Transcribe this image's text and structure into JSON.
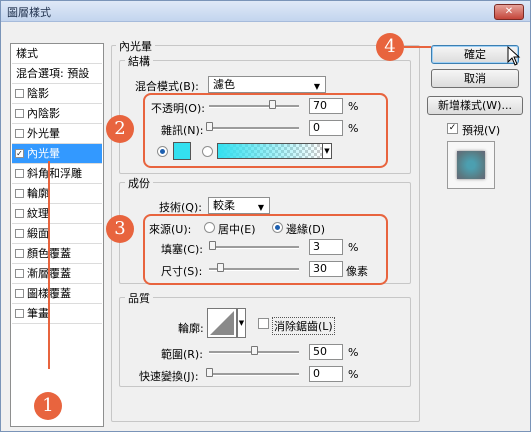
{
  "window": {
    "title": "圖層樣式",
    "close_label": "✕"
  },
  "sidebar": {
    "header": "樣式",
    "blend": "混合選項: 預設",
    "items": [
      {
        "label": "陰影",
        "checked": false
      },
      {
        "label": "內陰影",
        "checked": false
      },
      {
        "label": "外光暈",
        "checked": false
      },
      {
        "label": "內光暈",
        "checked": true
      },
      {
        "label": "斜角和浮雕",
        "checked": false
      },
      {
        "label": "輪廓",
        "checked": false
      },
      {
        "label": "紋理",
        "checked": false
      },
      {
        "label": "緞面",
        "checked": false
      },
      {
        "label": "顏色覆蓋",
        "checked": false
      },
      {
        "label": "漸層覆蓋",
        "checked": false
      },
      {
        "label": "圖樣覆蓋",
        "checked": false
      },
      {
        "label": "筆畫",
        "checked": false
      }
    ]
  },
  "inner_glow": {
    "title": "內光暈",
    "structure": {
      "title": "結構",
      "blend_label": "混合模式(B):",
      "blend_value": "濾色",
      "opacity_label": "不透明(O):",
      "opacity_value": "70",
      "opacity_unit": "%",
      "opacity_level": 0.7,
      "noise_label": "雜訊(N):",
      "noise_value": "0",
      "noise_unit": "%",
      "noise_level": 0.0,
      "glow_color": "#33e0f0"
    },
    "elements": {
      "title": "成份",
      "technique_label": "技術(Q):",
      "technique_value": "較柔",
      "source_label": "來源(U):",
      "source_center": "居中(E)",
      "source_edge": "邊緣(D)",
      "choke_label": "填塞(C):",
      "choke_value": "3",
      "choke_unit": "%",
      "choke_level": 0.03,
      "size_label": "尺寸(S):",
      "size_value": "30",
      "size_unit": "像素",
      "size_level": 0.12
    },
    "quality": {
      "title": "品質",
      "contour_label": "輪廓:",
      "antialias_label": "消除鋸齒(L)",
      "range_label": "範圍(R):",
      "range_value": "50",
      "range_unit": "%",
      "range_level": 0.5,
      "jitter_label": "快速變換(J):",
      "jitter_value": "0",
      "jitter_unit": "%",
      "jitter_level": 0.0
    }
  },
  "buttons": {
    "ok": "確定",
    "cancel": "取消",
    "new_style": "新增樣式(W)...",
    "preview": "預視(V)"
  },
  "callouts": [
    "1",
    "2",
    "3",
    "4"
  ],
  "colors": {
    "accent": "#e8643e",
    "selection": "#3399ff"
  }
}
